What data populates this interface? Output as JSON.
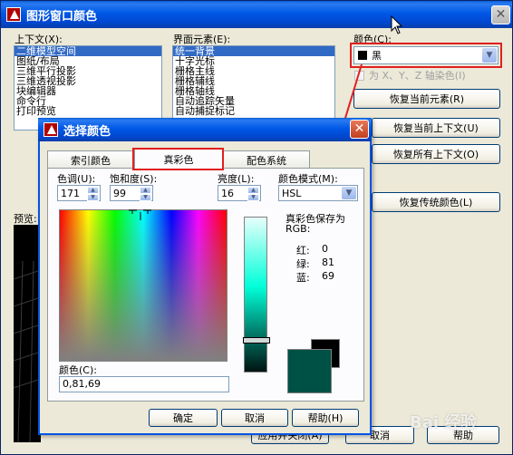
{
  "outer": {
    "title": "图形窗口颜色",
    "context_label": "上下文(X):",
    "context_items": [
      "二维模型空间",
      "图纸/布局",
      "三维平行投影",
      "三维透视投影",
      "块编辑器",
      "命令行",
      "打印预览"
    ],
    "element_label": "界面元素(E):",
    "element_items": [
      "统一背景",
      "十字光标",
      "栅格主线",
      "栅格辅线",
      "栅格轴线",
      "自动追踪矢量",
      "自动捕捉标记"
    ],
    "color_label": "颜色(C):",
    "color_value": "黑",
    "tint_label": "为 X、Y、Z 轴染色(I)",
    "restore_element": "恢复当前元素(R)",
    "restore_context": "恢复当前上下文(U)",
    "restore_all": "恢复所有上下文(O)",
    "restore_classic": "恢复传统颜色(L)",
    "preview_label": "预览:",
    "apply_close": "应用并关闭(A)",
    "cancel": "取消",
    "help": "帮助"
  },
  "dialog": {
    "title": "选择颜色",
    "tabs": [
      "索引颜色",
      "真彩色",
      "配色系统"
    ],
    "hue_label": "色调(U):",
    "hue_value": "171",
    "saturation_label": "饱和度(S):",
    "saturation_value": "99",
    "luminance_label": "亮度(L):",
    "luminance_value": "16",
    "color_mode_label": "颜色模式(M):",
    "color_mode_value": "HSL",
    "truecolor_storage_label": "真彩色保存为",
    "rgb_label": "RGB:",
    "red_label": "红:",
    "red_value": "0",
    "green_label": "绿:",
    "green_value": "81",
    "blue_label": "蓝:",
    "blue_value": "69",
    "color_field_label": "颜色(C):",
    "color_field_value": "0,81,69",
    "ok": "确定",
    "cancel": "取消",
    "help": "帮助(H)",
    "swatch_new_color": "#005145",
    "swatch_old_color": "#000000"
  },
  "watermark": "Bai 经验"
}
